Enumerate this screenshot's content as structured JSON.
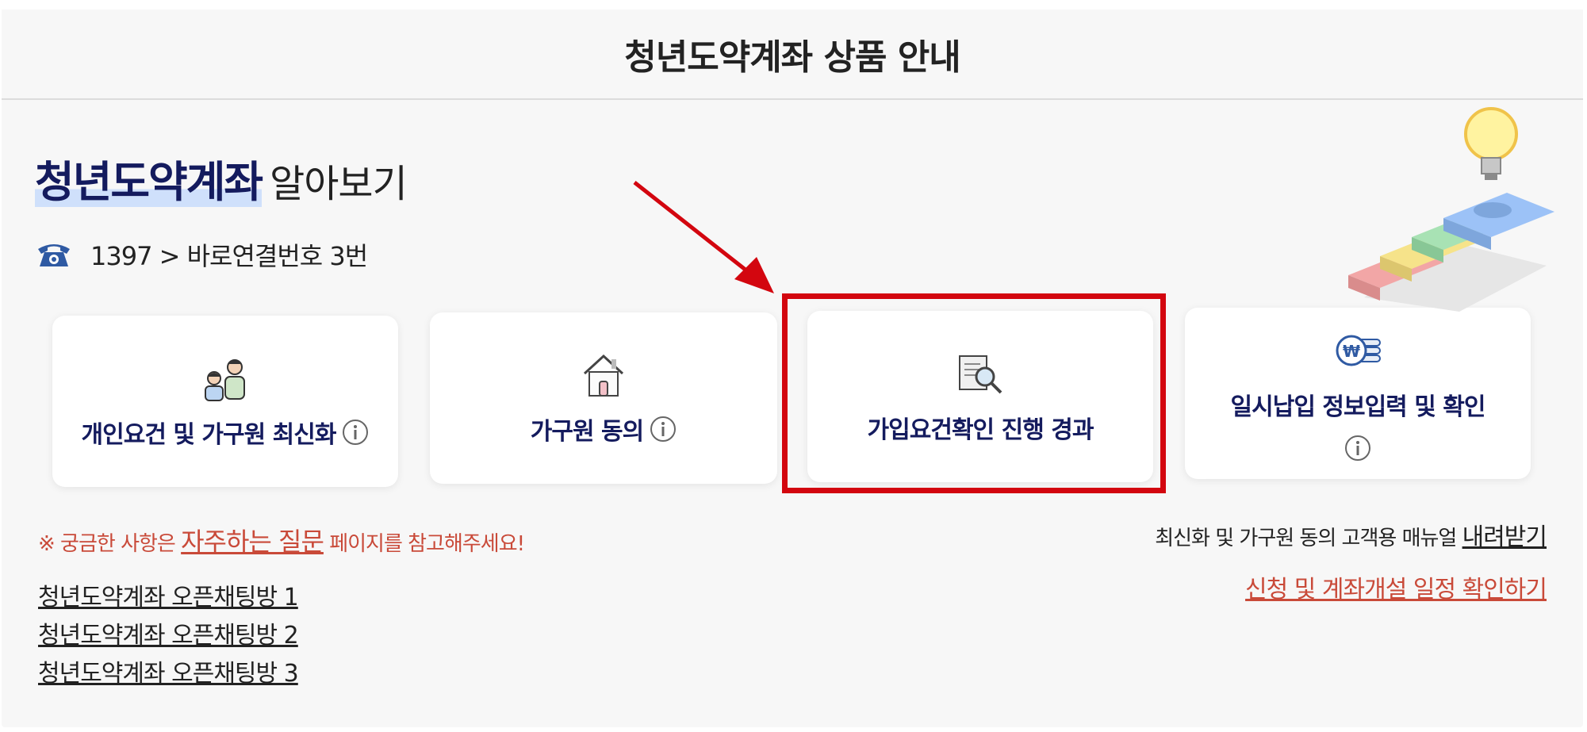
{
  "header": {
    "title": "청년도약계좌 상품 안내"
  },
  "intro": {
    "headline_bold": "청년도약계좌",
    "headline_rest": "알아보기",
    "phone": "1397 > 바로연결번호 3번"
  },
  "cards": [
    {
      "label": "개인요건 및 가구원 최신화",
      "icon": "family-icon"
    },
    {
      "label": "가구원 동의",
      "icon": "house-icon"
    },
    {
      "label": "가입요건확인 진행 경과",
      "icon": "document-search-icon"
    },
    {
      "label": "일시납입 정보입력 및 확인",
      "icon": "won-coins-icon"
    }
  ],
  "faq_notice": {
    "prefix": "※ 궁금한 사항은",
    "link": "자주하는 질문",
    "suffix": "페이지를 참고해주세요!"
  },
  "open_chats": [
    "청년도약계좌 오픈채팅방 1",
    "청년도약계좌 오픈채팅방 2",
    "청년도약계좌 오픈채팅방 3"
  ],
  "manual": {
    "text": "최신화 및 가구원 동의 고객용 매뉴얼",
    "link": "내려받기"
  },
  "schedule_link": "신청 및 계좌개설 일정 확인하기",
  "colors": {
    "navy": "#141b5e",
    "highlight_red": "#d3060f",
    "notice_red": "#c94a39"
  }
}
